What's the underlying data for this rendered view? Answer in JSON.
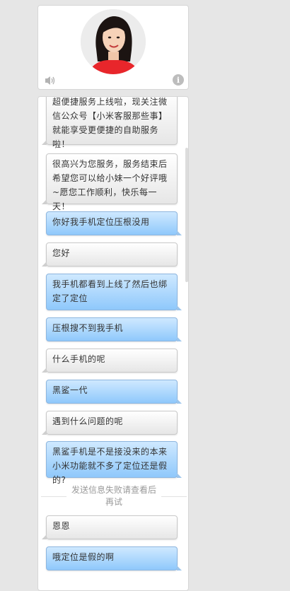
{
  "header": {
    "avatar_label": "customer service avatar",
    "speaker_icon": "speaker-icon",
    "info_icon": "info-icon",
    "info_glyph": "i"
  },
  "messages": [
    {
      "side": "left",
      "text": "超便捷服务上线啦，现关注微信公众号【小米客服那些事】就能享受更便捷的自助服务啦！"
    },
    {
      "side": "left",
      "text": "很高兴为您服务，服务结束后希望您可以给小妹一个好评哦~愿您工作顺利，快乐每一天！"
    },
    {
      "side": "right",
      "text": "你好我手机定位压根没用"
    },
    {
      "side": "left",
      "text": "您好"
    },
    {
      "side": "right",
      "text": "我手机都看到上线了然后也绑定了定位"
    },
    {
      "side": "right",
      "text": "压根搜不到我手机"
    },
    {
      "side": "left",
      "text": "什么手机的呢"
    },
    {
      "side": "right",
      "text": "黑鲨一代"
    },
    {
      "side": "left",
      "text": "遇到什么问题的呢"
    },
    {
      "side": "right",
      "text": "黑鲨手机是不是接没来的本来小米功能就不多了定位还是假的?"
    },
    {
      "side": "left",
      "text": "恩恩"
    },
    {
      "side": "right",
      "text": "哦定位是假的啊"
    }
  ],
  "system_notice": "发送信息失败请查看后再试",
  "colors": {
    "page_bg": "#e6e6e6",
    "user_bubble_top": "#cfe9ff",
    "user_bubble_bottom": "#8fc8fb",
    "agent_bubble_top": "#ffffff",
    "agent_bubble_bottom": "#e6e6e6"
  }
}
